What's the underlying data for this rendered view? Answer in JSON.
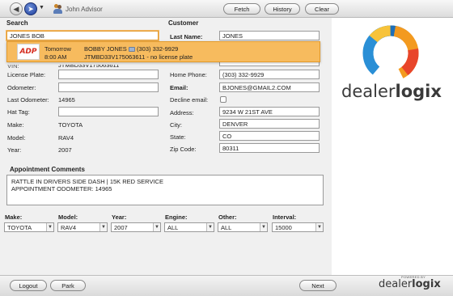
{
  "toolbar": {
    "advisor_name": "John Advisor",
    "fetch_label": "Fetch",
    "history_label": "History",
    "clear_label": "Clear"
  },
  "search": {
    "title": "Search",
    "query": "JONES BOB",
    "result": {
      "logo_text": "ADP",
      "day": "Tomorrow",
      "time": "8:00 AM",
      "name": "BOBBY JONES",
      "phone": "(303) 332-9929",
      "vin_note": "JTMBD33V175063611 - no license plate"
    }
  },
  "vehicle": {
    "vin_partial": "JTMBD33V175063611",
    "license_plate_label": "License Plate:",
    "license_plate": "",
    "odometer_label": "Odometer:",
    "odometer": "",
    "last_odometer_label": "Last Odometer:",
    "last_odometer": "14965",
    "hat_tag_label": "Hat Tag:",
    "hat_tag": "",
    "make_label": "Make:",
    "make": "TOYOTA",
    "model_label": "Model:",
    "model": "RAV4",
    "year_label": "Year:",
    "year": "2007"
  },
  "customer": {
    "title": "Customer",
    "last_name_label": "Last Name:",
    "last_name": "JONES",
    "home_phone_label": "Home Phone:",
    "home_phone": "(303) 332-9929",
    "email_label": "Email:",
    "email": "BJONES@GMAIL2.COM",
    "decline_email_label": "Decline email:",
    "address_label": "Address:",
    "address": "9234 W 21ST AVE",
    "city_label": "City:",
    "city": "DENVER",
    "state_label": "State:",
    "state": "CO",
    "zip_label": "Zip Code:",
    "zip": "80311"
  },
  "appointment": {
    "title": "Appointment Comments",
    "line1": "RATTLE IN DRIVERS SIDE DASH | 15K RED SERVICE",
    "line2": "APPOINTMENT ODOMETER: 14965"
  },
  "filters": {
    "make_label": "Make:",
    "make_value": "TOYOTA",
    "model_label": "Model:",
    "model_value": "RAV4",
    "year_label": "Year:",
    "year_value": "2007",
    "engine_label": "Engine:",
    "engine_value": "ALL",
    "other_label": "Other:",
    "other_value": "ALL",
    "interval_label": "Interval:",
    "interval_value": "15000"
  },
  "bottom": {
    "logout_label": "Logout",
    "park_label": "Park",
    "next_label": "Next",
    "powered_by": "POWERED BY"
  },
  "brand": {
    "name_regular": "dealer",
    "name_bold": "logix"
  },
  "colors": {
    "dropdown_bg": "#f7bb5e",
    "search_border": "#e39a2a",
    "adp_red": "#d52b1e",
    "logo_orange": "#f39a1f",
    "logo_blue": "#2a8fd6"
  }
}
